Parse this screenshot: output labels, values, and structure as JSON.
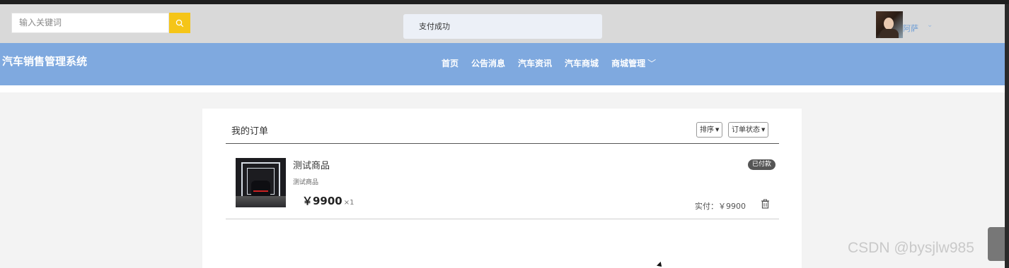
{
  "header": {
    "search_placeholder": "输入关键词",
    "toast_message": "支付成功",
    "user_name": "阿萨",
    "user_caret": "⌄"
  },
  "navbar": {
    "brand": "汽车销售管理系统",
    "items": [
      {
        "label": "首页"
      },
      {
        "label": "公告消息"
      },
      {
        "label": "汽车资讯"
      },
      {
        "label": "汽车商城"
      },
      {
        "label": "商城管理"
      }
    ],
    "dropdown_chevron": "﹀"
  },
  "orders": {
    "title": "我的订单",
    "sort_label": "排序",
    "status_filter_label": "订单状态",
    "caret": "▼",
    "items": [
      {
        "name": "测试商品",
        "description": "测试商品",
        "price": "￥9900",
        "quantity": "×1",
        "status": "已付款",
        "paid": "实付：￥9900",
        "icon": "trash-icon"
      }
    ]
  },
  "watermark": "CSDN @bysjlw985",
  "colors": {
    "navbar": "#7fa9df",
    "search_button": "#f5c518",
    "topbar": "#d9d9d9",
    "badge": "#555555"
  }
}
